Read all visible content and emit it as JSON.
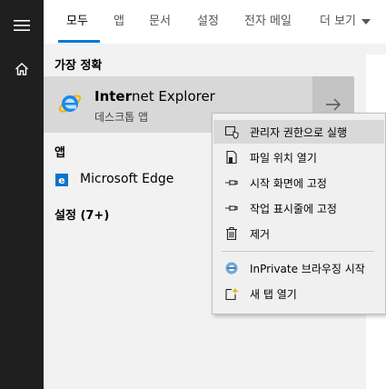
{
  "rail": {
    "menu_icon": "hamburger-menu-icon",
    "home_icon": "home-icon"
  },
  "tabs": [
    {
      "label": "모두",
      "active": true
    },
    {
      "label": "앱",
      "active": false
    },
    {
      "label": "문서",
      "active": false
    },
    {
      "label": "설정",
      "active": false
    },
    {
      "label": "전자 메일",
      "active": false
    }
  ],
  "more_tab": {
    "label": "더 보기",
    "icon": "caret-down-icon"
  },
  "best_match": {
    "heading": "가장 정확",
    "app_name_match": "Inter",
    "app_name_rest": "net Explorer",
    "app_type": "데스크톱 앱",
    "icon": "internet-explorer-icon",
    "arrow_icon": "arrow-right-icon"
  },
  "apps_section": {
    "heading": "앱",
    "items": [
      {
        "label": "Microsoft Edge",
        "icon": "microsoft-edge-icon"
      }
    ]
  },
  "settings_section": {
    "heading": "설정 (7+)"
  },
  "context_menu": {
    "items": [
      {
        "label": "관리자 권한으로 실행",
        "icon": "run-as-admin-icon",
        "hover": true
      },
      {
        "label": "파일 위치 열기",
        "icon": "file-location-icon"
      },
      {
        "label": "시작 화면에 고정",
        "icon": "pin-icon"
      },
      {
        "label": "작업 표시줄에 고정",
        "icon": "pin-icon"
      },
      {
        "label": "제거",
        "icon": "trash-icon"
      },
      {
        "label": "InPrivate 브라우징 시작",
        "icon": "inprivate-icon"
      },
      {
        "label": "새 탭 열기",
        "icon": "new-tab-icon"
      }
    ]
  },
  "colors": {
    "rail": "#1f1f1f",
    "accent": "#0078d7",
    "selected_row": "#d8d8d8",
    "menu_bg": "#f0f0f0"
  }
}
